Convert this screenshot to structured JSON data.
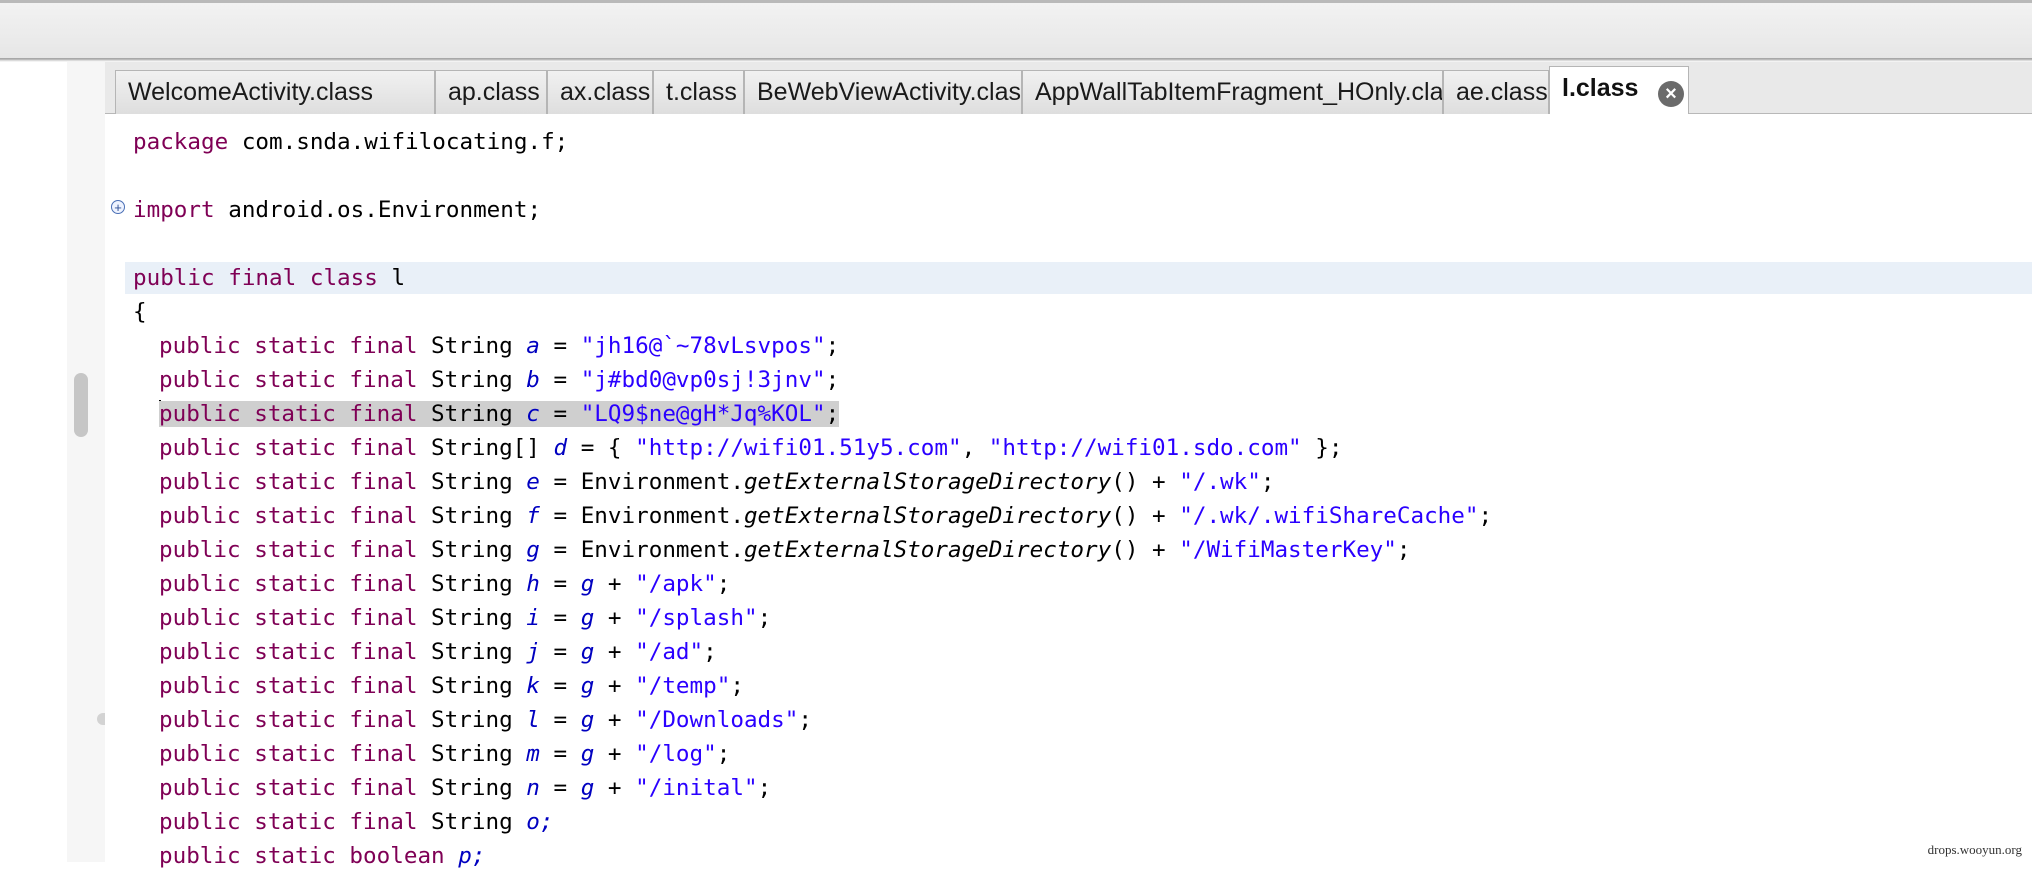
{
  "tabs": [
    {
      "label": "WelcomeActivity.class",
      "active": false
    },
    {
      "label": "ap.class",
      "active": false
    },
    {
      "label": "ax.class",
      "active": false
    },
    {
      "label": "t.class",
      "active": false
    },
    {
      "label": "BeWebViewActivity.class",
      "active": false
    },
    {
      "label": "AppWallTabItemFragment_HOnly.class",
      "active": false
    },
    {
      "label": "ae.class",
      "active": false
    },
    {
      "label": "l.class",
      "active": true
    }
  ],
  "code": {
    "package_kw": "package",
    "package_name": " com.snda.wifilocating.f;",
    "import_kw": "import",
    "import_name": " android.os.Environment;",
    "class_decl": {
      "public": "public",
      "final": " final",
      "class": " class",
      "name": " l"
    },
    "open_brace": "{",
    "fields": [
      {
        "name": "a",
        "rhs_type": "str",
        "value": "\"jh16@`~78vLsvpos\""
      },
      {
        "name": "b",
        "rhs_type": "str",
        "value": "\"j#bd0@vp0sj!3jnv\""
      },
      {
        "name": "c",
        "rhs_type": "str",
        "value": "\"LQ9$ne@gH*Jq%KOL\""
      },
      {
        "name": "e",
        "rhs_type": "env",
        "value": "\"/.wk\""
      },
      {
        "name": "f",
        "rhs_type": "env",
        "value": "\"/.wk/.wifiShareCache\""
      },
      {
        "name": "g",
        "rhs_type": "env",
        "value": "\"/WifiMasterKey\""
      },
      {
        "name": "h",
        "rhs_type": "g",
        "value": "\"/apk\""
      },
      {
        "name": "i",
        "rhs_type": "g",
        "value": "\"/splash\""
      },
      {
        "name": "j",
        "rhs_type": "g",
        "value": "\"/ad\""
      },
      {
        "name": "k",
        "rhs_type": "g",
        "value": "\"/temp\""
      },
      {
        "name": "l",
        "rhs_type": "g",
        "value": "\"/Downloads\""
      },
      {
        "name": "m",
        "rhs_type": "g",
        "value": "\"/log\""
      },
      {
        "name": "n",
        "rhs_type": "g",
        "value": "\"/inital\""
      }
    ],
    "array_field": {
      "name": "d",
      "url1": "\"http://wifi01.51y5.com\"",
      "url2": "\"http://wifi01.sdo.com\""
    },
    "tokens": {
      "modifiers": "public static final",
      "type_string": " String ",
      "type_array": " String[] ",
      "eq": " = ",
      "env": "Environment.",
      "method": "getExternalStorageDirectory",
      "paren": "() + ",
      "g_ref": "g",
      "plus": " + ",
      "semi": ";",
      "arr_open": " = { ",
      "comma": ", ",
      "arr_close": " };",
      "o_decl": "o;",
      "bool_mods": "public static boolean",
      "p_decl": "p;"
    }
  },
  "watermark": "drops.wooyun.org"
}
